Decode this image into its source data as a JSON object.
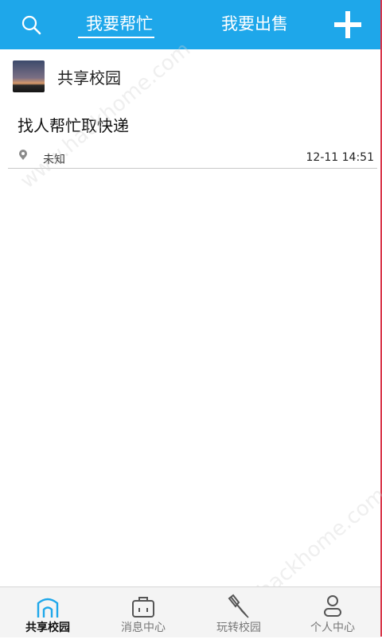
{
  "header": {
    "tabs": [
      {
        "label": "我要帮忙",
        "active": true
      },
      {
        "label": "我要出售",
        "active": false
      }
    ],
    "search_icon": "search-icon",
    "add_icon": "plus-icon"
  },
  "post": {
    "username": "共享校园",
    "title": "找人帮忙取快递",
    "location": "未知",
    "time": "12-11 14:51"
  },
  "bottom_nav": {
    "items": [
      {
        "label": "共享校园",
        "icon": "campus-home-icon",
        "active": true
      },
      {
        "label": "消息中心",
        "icon": "message-bag-icon",
        "active": false
      },
      {
        "label": "玩转校园",
        "icon": "pen-explore-icon",
        "active": false
      },
      {
        "label": "个人中心",
        "icon": "person-icon",
        "active": false
      }
    ]
  },
  "watermark": "www.hackhome.com",
  "colors": {
    "header_bg": "#1ea7ea",
    "active_nav_icon": "#1ea7ea",
    "right_edge": "#d9364a"
  }
}
